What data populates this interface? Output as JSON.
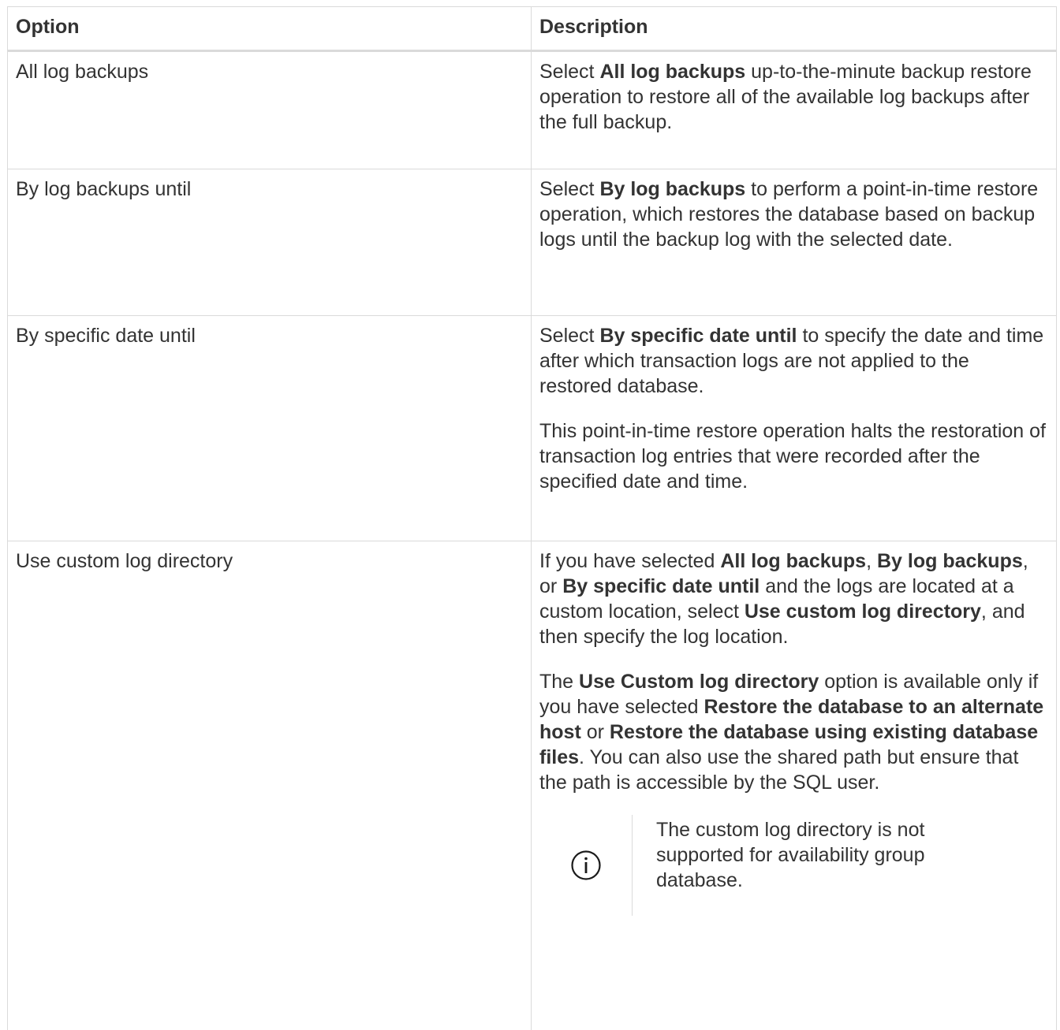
{
  "table": {
    "headers": [
      "Option",
      "Description"
    ],
    "rows": [
      {
        "option": "All log backups",
        "description": [
          [
            {
              "t": "Select "
            },
            {
              "t": "All log backups",
              "b": true
            },
            {
              "t": " up-to-the-minute backup restore operation to restore all of the available log backups after the full backup."
            }
          ]
        ]
      },
      {
        "option": "By log backups until",
        "description": [
          [
            {
              "t": "Select "
            },
            {
              "t": "By log backups",
              "b": true
            },
            {
              "t": " to perform a point-in-time restore operation, which restores the database based on backup logs until the backup log with the selected date."
            }
          ]
        ]
      },
      {
        "option": "By specific date until",
        "description": [
          [
            {
              "t": "Select "
            },
            {
              "t": "By specific date until",
              "b": true
            },
            {
              "t": " to specify the date and time after which transaction logs are not applied to the restored database."
            }
          ],
          [
            {
              "t": "This point-in-time restore operation halts the restoration of transaction log entries that were recorded after the specified date and time."
            }
          ]
        ]
      },
      {
        "option": "Use custom log directory",
        "description": [
          [
            {
              "t": "If you have selected "
            },
            {
              "t": "All log backups",
              "b": true
            },
            {
              "t": ", "
            },
            {
              "t": "By log backups",
              "b": true
            },
            {
              "t": ", or "
            },
            {
              "t": "By specific date until",
              "b": true
            },
            {
              "t": " and the logs are located at a custom location, select "
            },
            {
              "t": "Use custom log directory",
              "b": true
            },
            {
              "t": ", and then specify the log location."
            }
          ],
          [
            {
              "t": "The "
            },
            {
              "t": "Use Custom log directory",
              "b": true
            },
            {
              "t": " option is available only if you have selected "
            },
            {
              "t": "Restore the database to an alternate host",
              "b": true
            },
            {
              "t": " or "
            },
            {
              "t": "Restore the database using existing database files",
              "b": true
            },
            {
              "t": ". You can also use the shared path but ensure that the path is accessible by the SQL user."
            }
          ]
        ],
        "note": {
          "icon": "info-icon",
          "text": "The custom log directory is not supported for availability group database."
        }
      }
    ]
  },
  "colors": {
    "text": "#333333",
    "border": "#dadada",
    "icon": "#1a1a1a"
  }
}
